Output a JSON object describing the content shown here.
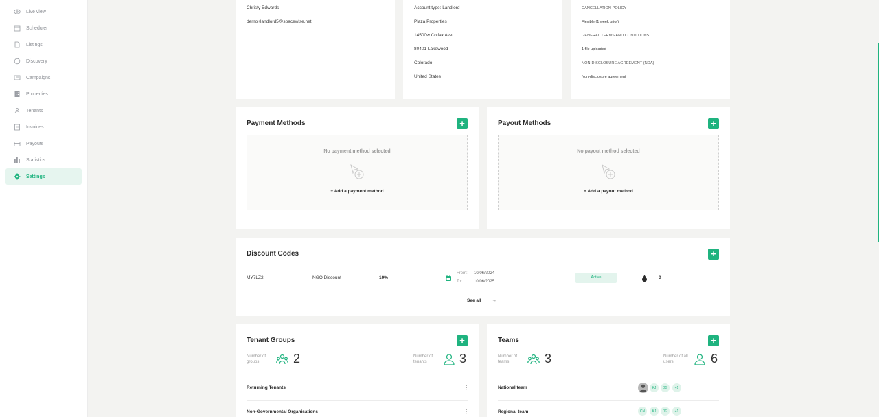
{
  "sidebar": {
    "items": [
      {
        "label": "Live view",
        "icon": "eye-icon"
      },
      {
        "label": "Scheduler",
        "icon": "calendar-icon"
      },
      {
        "label": "Listings",
        "icon": "document-icon"
      },
      {
        "label": "Discovery",
        "icon": "chat-icon"
      },
      {
        "label": "Campaigns",
        "icon": "megaphone-icon"
      },
      {
        "label": "Properties",
        "icon": "building-icon"
      },
      {
        "label": "Tenants",
        "icon": "people-icon"
      },
      {
        "label": "Invoices",
        "icon": "invoice-icon"
      },
      {
        "label": "Payouts",
        "icon": "wallet-icon"
      },
      {
        "label": "Statistics",
        "icon": "bar-chart-icon"
      },
      {
        "label": "Settings",
        "icon": "gear-icon",
        "active": true
      }
    ]
  },
  "profile": {
    "name": "Christy Edwards",
    "email": "demo+landlord5@spacewise.net"
  },
  "account": {
    "type": "Account type: Landlord",
    "company": "Plaza Properties",
    "street": "14500w Colfax Ave",
    "city": "80401 Lakewood",
    "state": "Colorado",
    "country": "United States"
  },
  "policies": {
    "cancellation_title": "CANCELLATION POLICY",
    "cancellation_value": "Flexible (1 week prior)",
    "terms_title": "GENERAL TERMS AND CONDITIONS",
    "terms_value": "1 file uploaded",
    "nda_title": "NON-DISCLOSURE AGREEMENT (NDA)",
    "nda_value": "Non-disclosure agreement"
  },
  "payment_methods": {
    "title": "Payment Methods",
    "empty": "No payment method selected",
    "add": "+ Add a payment method"
  },
  "payout_methods": {
    "title": "Payout Methods",
    "empty": "No payout method selected",
    "add": "+ Add a payout method"
  },
  "discount_codes": {
    "title": "Discount Codes",
    "rows": [
      {
        "code": "MY7LZ2",
        "name": "NGO Discount",
        "percent": "10%",
        "from_label": "From:",
        "from": "10/06/2024",
        "to_label": "To:",
        "to": "10/06/2025",
        "status": "Active",
        "uses": "0"
      }
    ],
    "see_all": "See all",
    "see_all_arrow": "→"
  },
  "tenant_groups": {
    "title": "Tenant Groups",
    "groups_label": "Number of groups",
    "groups_count": "2",
    "tenants_label": "Number of tenants",
    "tenants_count": "3",
    "rows": [
      "Returning Tenants",
      "Non-Governmental Organisations"
    ]
  },
  "teams": {
    "title": "Teams",
    "teams_label": "Number of teams",
    "teams_count": "3",
    "users_label": "Number of all users",
    "users_count": "6",
    "rows": [
      {
        "name": "National team",
        "avatars": [
          "KJ",
          "DG",
          "+1"
        ]
      },
      {
        "name": "Regional team",
        "avatars": [
          "CN",
          "KJ",
          "DG",
          "+1"
        ]
      }
    ]
  },
  "colors": {
    "accent": "#1fb37f",
    "background": "#f3f3f1"
  }
}
